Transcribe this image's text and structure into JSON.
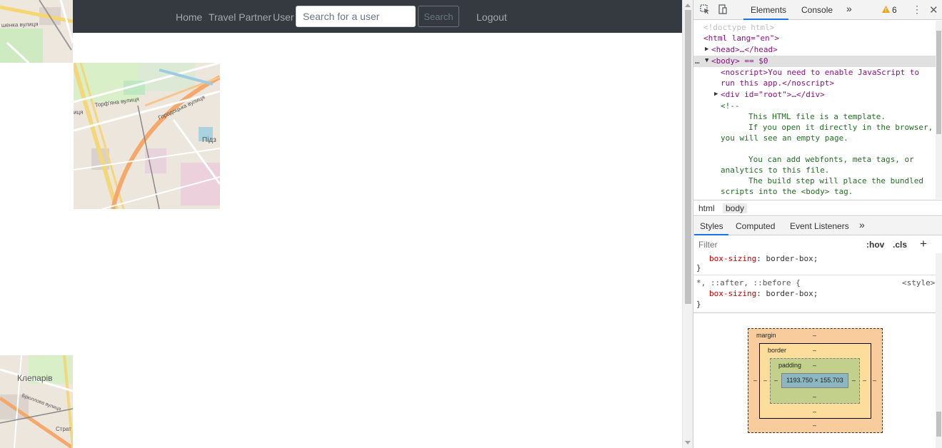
{
  "navbar": {
    "links": [
      "Home",
      "Travel Partner",
      "User"
    ],
    "search_placeholder": "Search for a user",
    "search_button": "Search",
    "logout": "Logout"
  },
  "map_labels": {
    "tile_top_left": "шенка вулиця",
    "tile_main_1": "Торф'яна вулиця",
    "tile_main_2": "Городоцька вулиця",
    "tile_main_3": "Підз",
    "tile_main_4": "иця",
    "tile_bottom_1": "Клепарів",
    "tile_bottom_2": "Брюллова вулиця",
    "tile_bottom_3": "Страт"
  },
  "devtools": {
    "tabs": [
      "Elements",
      "Console"
    ],
    "more": "»",
    "warnings": "6",
    "elements_lines": {
      "doctype": "<!doctype html>",
      "html_open": "<html lang=\"en\">",
      "head": "<head>…</head>",
      "body": "<body> == $0",
      "noscript_1": "<noscript>You need to enable JavaScript to",
      "noscript_2": "run this app.</noscript>",
      "div_root": "<div id=\"root\">…</div>",
      "comment_open": "<!--",
      "comment_1": "This HTML file is a template.",
      "comment_2": "If you open it directly in the browser,",
      "comment_3": "you will see an empty page.",
      "comment_4": "You can add webfonts, meta tags, or",
      "comment_5": "analytics to this file.",
      "comment_6": "The build step will place the bundled",
      "comment_7": "scripts into the <body> tag."
    },
    "breadcrumbs": [
      "html",
      "body"
    ],
    "styles_tabs": [
      "Styles",
      "Computed",
      "Event Listeners"
    ],
    "filter_placeholder": "Filter",
    "hov": ":hov",
    "cls": ".cls",
    "plus": "+",
    "rules": {
      "r1_prop": "box-sizing",
      "r1_val": "border-box;",
      "r2_selector": "*, ::after, ::before {",
      "r2_source": "<style>",
      "r2_prop": "box-sizing",
      "r2_val": "border-box;",
      "close_brace": "}"
    },
    "box_model": {
      "margin_label": "margin",
      "border_label": "border",
      "padding_label": "padding",
      "dash": "–",
      "content": "1193.750 × 155.703"
    }
  }
}
